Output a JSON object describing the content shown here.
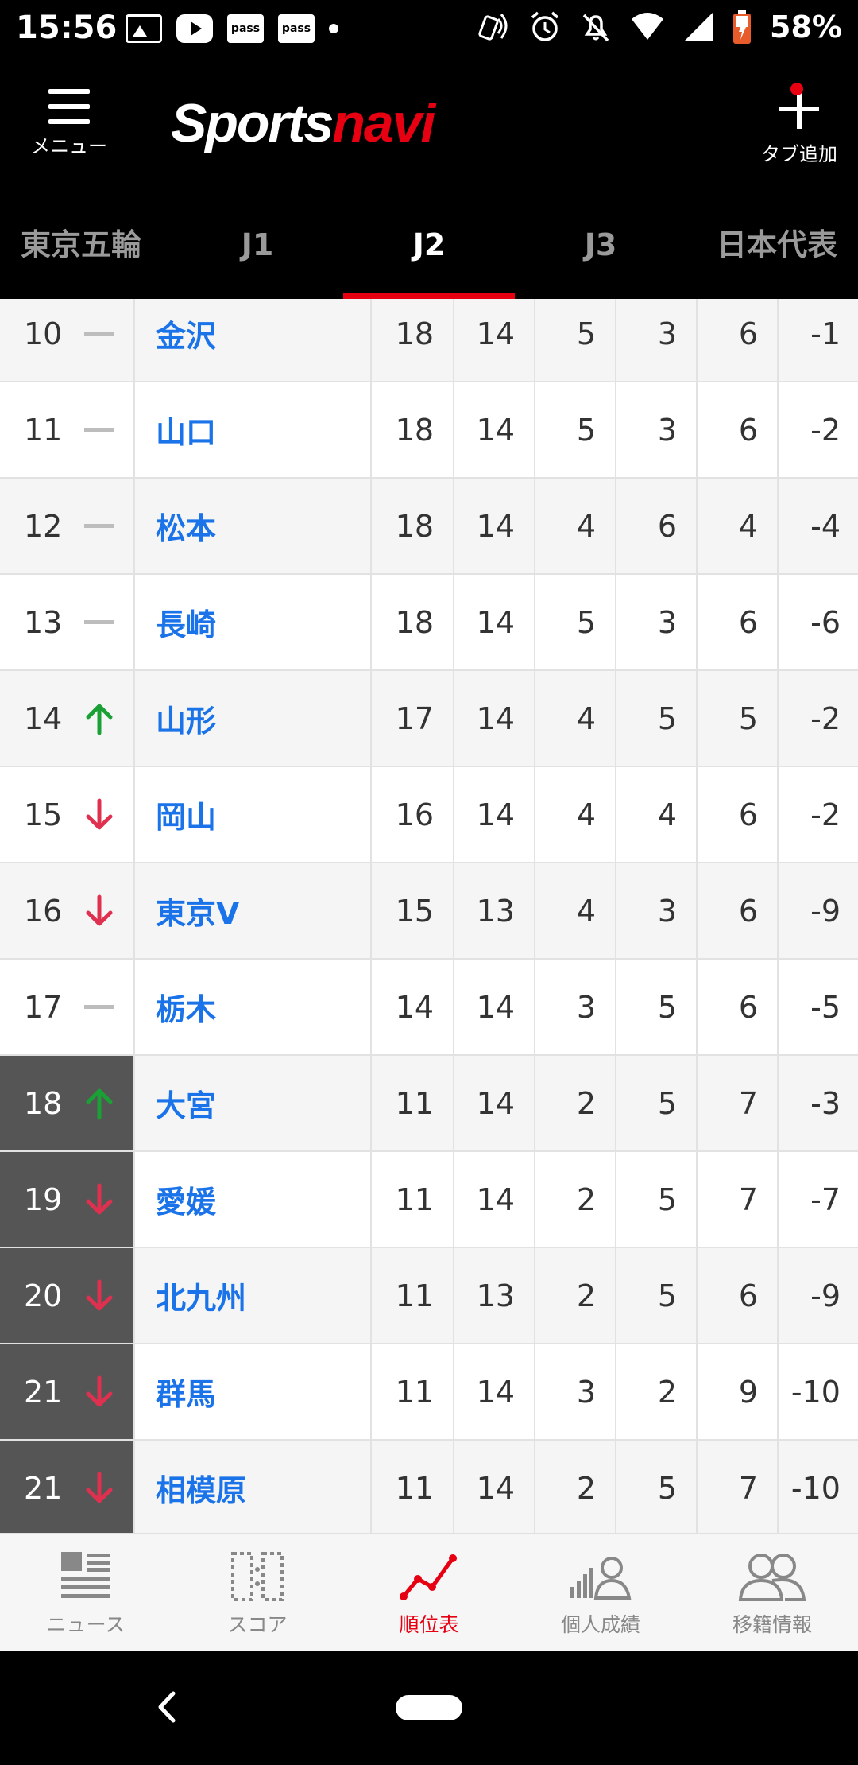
{
  "status_bar": {
    "time": "15:56",
    "battery": "58%",
    "notif_icons": [
      "image-icon",
      "youtube-icon",
      "pass-icon",
      "pass-icon"
    ],
    "pass_label": "pass"
  },
  "header": {
    "menu_label": "メニュー",
    "logo_part1": "Sports",
    "logo_part2": "navi",
    "add_tab_label": "タブ追加"
  },
  "tabs": [
    {
      "label": "東京五輪",
      "active": false
    },
    {
      "label": "J1",
      "active": false
    },
    {
      "label": "J2",
      "active": true
    },
    {
      "label": "J3",
      "active": false
    },
    {
      "label": "日本代表",
      "active": false
    }
  ],
  "standings": [
    {
      "rank": "10",
      "trend": "flat",
      "team": "金沢",
      "pts": "18",
      "p": "14",
      "w": "5",
      "d": "3",
      "l": "6",
      "gd": "-1",
      "danger": false
    },
    {
      "rank": "11",
      "trend": "flat",
      "team": "山口",
      "pts": "18",
      "p": "14",
      "w": "5",
      "d": "3",
      "l": "6",
      "gd": "-2",
      "danger": false
    },
    {
      "rank": "12",
      "trend": "flat",
      "team": "松本",
      "pts": "18",
      "p": "14",
      "w": "4",
      "d": "6",
      "l": "4",
      "gd": "-4",
      "danger": false
    },
    {
      "rank": "13",
      "trend": "flat",
      "team": "長崎",
      "pts": "18",
      "p": "14",
      "w": "5",
      "d": "3",
      "l": "6",
      "gd": "-6",
      "danger": false
    },
    {
      "rank": "14",
      "trend": "up",
      "team": "山形",
      "pts": "17",
      "p": "14",
      "w": "4",
      "d": "5",
      "l": "5",
      "gd": "-2",
      "danger": false
    },
    {
      "rank": "15",
      "trend": "down",
      "team": "岡山",
      "pts": "16",
      "p": "14",
      "w": "4",
      "d": "4",
      "l": "6",
      "gd": "-2",
      "danger": false
    },
    {
      "rank": "16",
      "trend": "down",
      "team": "東京V",
      "pts": "15",
      "p": "13",
      "w": "4",
      "d": "3",
      "l": "6",
      "gd": "-9",
      "danger": false
    },
    {
      "rank": "17",
      "trend": "flat",
      "team": "栃木",
      "pts": "14",
      "p": "14",
      "w": "3",
      "d": "5",
      "l": "6",
      "gd": "-5",
      "danger": false
    },
    {
      "rank": "18",
      "trend": "up",
      "team": "大宮",
      "pts": "11",
      "p": "14",
      "w": "2",
      "d": "5",
      "l": "7",
      "gd": "-3",
      "danger": true
    },
    {
      "rank": "19",
      "trend": "down",
      "team": "愛媛",
      "pts": "11",
      "p": "14",
      "w": "2",
      "d": "5",
      "l": "7",
      "gd": "-7",
      "danger": true
    },
    {
      "rank": "20",
      "trend": "down",
      "team": "北九州",
      "pts": "11",
      "p": "13",
      "w": "2",
      "d": "5",
      "l": "6",
      "gd": "-9",
      "danger": true
    },
    {
      "rank": "21",
      "trend": "down",
      "team": "群馬",
      "pts": "11",
      "p": "14",
      "w": "3",
      "d": "2",
      "l": "9",
      "gd": "-10",
      "danger": true
    },
    {
      "rank": "21",
      "trend": "down",
      "team": "相模原",
      "pts": "11",
      "p": "14",
      "w": "2",
      "d": "5",
      "l": "7",
      "gd": "-10",
      "danger": true
    }
  ],
  "bottom_nav": [
    {
      "label": "ニュース",
      "icon": "news-icon",
      "active": false
    },
    {
      "label": "スコア",
      "icon": "score-icon",
      "active": false
    },
    {
      "label": "順位表",
      "icon": "standings-chart-icon",
      "active": true
    },
    {
      "label": "個人成績",
      "icon": "player-stats-icon",
      "active": false
    },
    {
      "label": "移籍情報",
      "icon": "transfer-icon",
      "active": false
    }
  ],
  "colors": {
    "accent": "#e60012",
    "team_link": "#1a73e8",
    "trend_up": "#1aa035",
    "trend_down": "#e03050",
    "relegation_bg": "#555555"
  }
}
